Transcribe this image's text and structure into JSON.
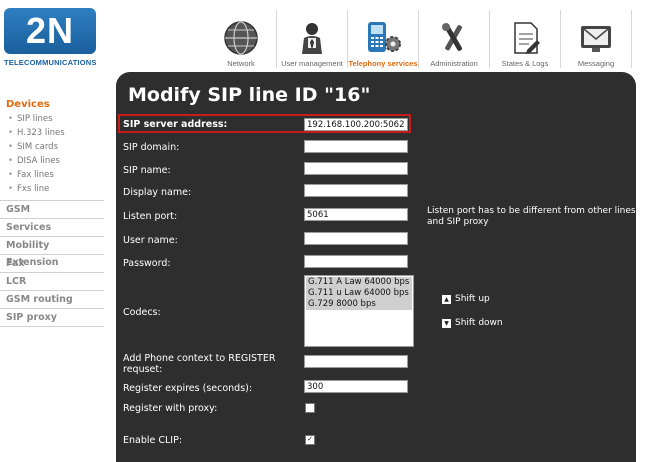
{
  "logo": {
    "text": "2N",
    "subtitle": "TELECOMMUNICATIONS"
  },
  "nav": [
    {
      "label": "Network",
      "icon": "network-globe-icon",
      "active": false
    },
    {
      "label": "User management",
      "icon": "user-management-icon",
      "active": false
    },
    {
      "label": "Telephony services",
      "icon": "telephony-services-icon",
      "active": true
    },
    {
      "label": "Administration",
      "icon": "administration-tools-icon",
      "active": false
    },
    {
      "label": "States & Logs",
      "icon": "states-logs-icon",
      "active": false
    },
    {
      "label": "Messaging",
      "icon": "messaging-icon",
      "active": false
    }
  ],
  "sidebar": {
    "heading": "Devices",
    "subitems": [
      "SIP lines",
      "H.323 lines",
      "SIM cards",
      "DISA lines",
      "Fax lines",
      "Fxs line"
    ],
    "items": [
      "GSM",
      "Services",
      "Mobility Extension",
      "Fax",
      "LCR",
      "GSM routing",
      "SIP proxy"
    ]
  },
  "form": {
    "title": "Modify SIP line ID \"16\"",
    "sip_server_label": "SIP server address:",
    "sip_server_value": "192.168.100.200:5062",
    "sip_domain_label": "SIP domain:",
    "sip_domain_value": "",
    "sip_name_label": "SIP name:",
    "sip_name_value": "",
    "display_name_label": "Display name:",
    "display_name_value": "",
    "listen_port_label": "Listen port:",
    "listen_port_value": "5061",
    "listen_port_hint": "Listen port has to be different from other lines and SIP proxy",
    "user_name_label": "User name:",
    "user_name_value": "",
    "password_label": "Password:",
    "password_value": "",
    "codecs_label": "Codecs:",
    "codecs": [
      "G.711 A Law 64000 bps",
      "G.711 u Law 64000 bps",
      "G.729 8000 bps"
    ],
    "shift_up": "Shift up",
    "shift_down": "Shift down",
    "phone_context_label": "Add Phone context to REGISTER requset:",
    "phone_context_value": "",
    "register_expires_label": "Register expires (seconds):",
    "register_expires_value": "300",
    "register_proxy_label": "Register with proxy:",
    "register_proxy_checked": false,
    "enable_clip_label": "Enable CLIP:",
    "enable_clip_checked": true
  },
  "colors": {
    "brand_blue": "#1a5f9e",
    "accent_orange": "#e06a10",
    "panel_bg": "#2e2e2e",
    "highlight_red": "#c81c1c"
  }
}
